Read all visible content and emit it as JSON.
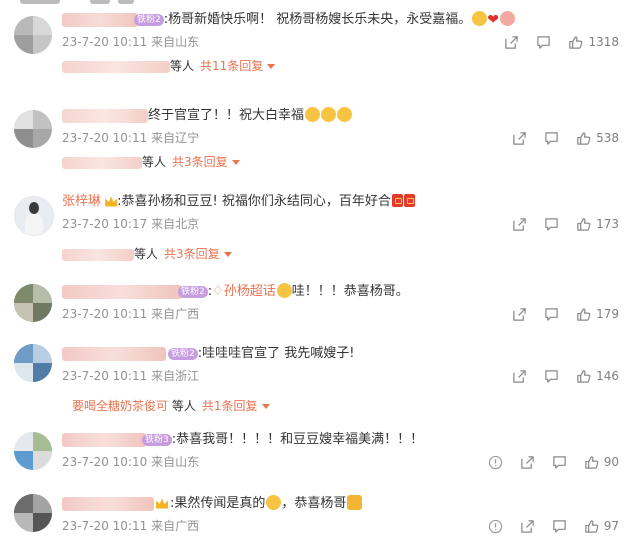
{
  "comments": [
    {
      "text": ":杨哥新婚快乐啊！ 祝杨哥杨嫂长乐未央，永受嘉福。",
      "badge": "铁粉2",
      "time": "23-7-20 10:11",
      "location": "来自山东",
      "likes": "1318",
      "reply_suffix": "等人",
      "reply_more": "共11条回复"
    },
    {
      "text": "终于官宣了！！祝大白幸福",
      "time": "23-7-20 10:11",
      "location": "来自辽宁",
      "likes": "538",
      "reply_suffix": "等人",
      "reply_more": "共3条回复"
    },
    {
      "name": "张梓琳",
      "text": ":恭喜孙杨和豆豆! 祝福你们永结同心，百年好合",
      "time": "23-7-20 10:17",
      "location": "来自北京",
      "likes": "173",
      "reply_suffix": "等人",
      "reply_more": "共3条回复"
    },
    {
      "badge": "铁粉2",
      "mention": "孙杨超话",
      "text": "哇！！！恭喜杨哥。",
      "time": "23-7-20 10:11",
      "location": "来自广西",
      "likes": "179"
    },
    {
      "badge": "铁粉2",
      "text": ":哇哇哇官宣了 我先喊嫂子!",
      "time": "23-7-20 10:11",
      "location": "来自浙江",
      "likes": "146",
      "reply_user": "要喝全糖奶茶俊可",
      "reply_suffix": "等人",
      "reply_more": "共1条回复"
    },
    {
      "badge": "铁粉3",
      "text": ":恭喜我哥！！！！和豆豆嫂幸福美满！！！",
      "time": "23-7-20 10:10",
      "location": "来自山东",
      "likes": "90"
    },
    {
      "text": ":果然传闻是真的",
      "text2": "，恭喜杨哥",
      "time": "23-7-20 10:11",
      "location": "来自广西",
      "likes": "97"
    }
  ],
  "icons": {
    "share": "share-icon",
    "comment": "comment-icon",
    "like": "thumbs-up-icon",
    "warn": "exclamation-icon"
  },
  "colors": {
    "accent": "#eb7350",
    "meta": "#939393",
    "fan_badge": "#c79de0"
  }
}
